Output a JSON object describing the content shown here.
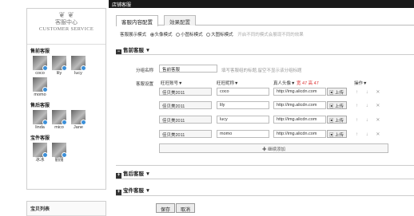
{
  "window_title": "店铺客服",
  "tabs": [
    "客服内容配置",
    "效果配置"
  ],
  "display_mode": {
    "label": "客服展示模式",
    "options": [
      "头像模式",
      "小图标模式",
      "大图标模式"
    ],
    "selected": "头像模式",
    "hint": "开启不同的模式会展现不同的效果"
  },
  "group_presale": {
    "title": "售前客服 ▼",
    "name_label": "分组名称",
    "name_value": "售前客服",
    "name_hint": "填写客服组的标题,留空不显示该分组标题",
    "settings_label": "客服设置",
    "col_account": "旺旺账号▼",
    "col_nick": "旺旺昵称▼",
    "col_avatar": "真人头像▼",
    "col_avatar_size": "宽 47 高 47",
    "col_ops": "操作▼",
    "rows": [
      {
        "account": "佳贝美2011",
        "nick": "coco",
        "avatar": "http://img.alicdn.com",
        "upload": "上传"
      },
      {
        "account": "佳贝美2011",
        "nick": "lily",
        "avatar": "http://img.alicdn.com",
        "upload": "上传"
      },
      {
        "account": "佳贝美2011",
        "nick": "lucy",
        "avatar": "http://img.alicdn.com",
        "upload": "上传"
      },
      {
        "account": "佳贝美2011",
        "nick": "momo",
        "avatar": "http://img.alicdn.com",
        "upload": "上传"
      }
    ],
    "row_ops": "↑ ↓ ✕",
    "add_more": "✚ 继续添加"
  },
  "group_aftersale": {
    "title": "售后客服 ▼"
  },
  "group_manager": {
    "title": "宝件客服 ▼"
  },
  "buttons": {
    "save": "保存",
    "cancel": "取消"
  },
  "preview": {
    "banner_cn": "客服中心",
    "banner_en": "CUSTOMER SERVICE",
    "sections": [
      {
        "title": "售前客服",
        "names": [
          "coco",
          "lily",
          "lucy",
          "momo"
        ]
      },
      {
        "title": "售后客服",
        "names": [
          "linda",
          "mico",
          "Jane"
        ]
      },
      {
        "title": "宝件客服",
        "names": [
          "冰冰",
          "丽丽"
        ]
      }
    ],
    "bottom_title": "宝贝列表"
  },
  "colors": {
    "accent": "#3b8fd8",
    "topbar": "#1a1a1a",
    "price_red": "#d33333"
  }
}
